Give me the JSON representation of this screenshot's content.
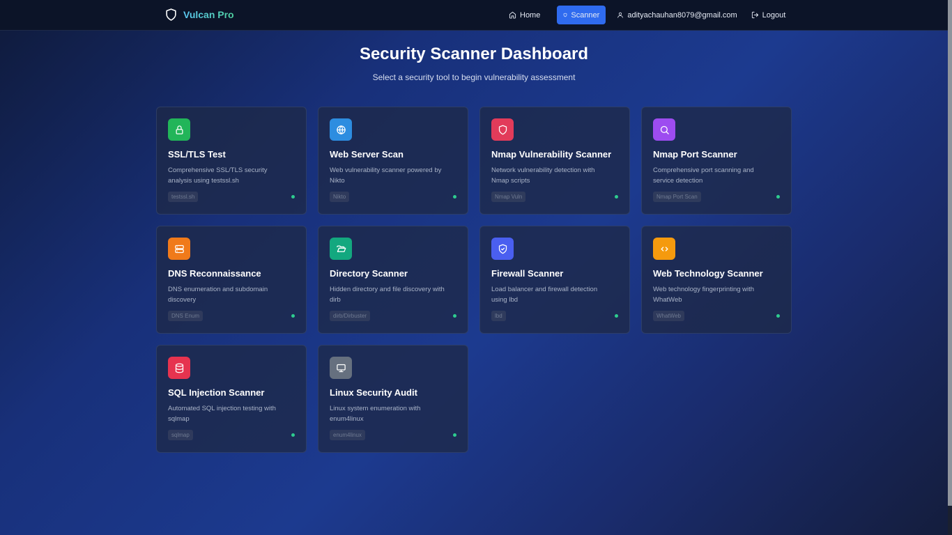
{
  "nav": {
    "brand": "Vulcan Pro",
    "home": "Home",
    "scanner": "Scanner",
    "user_email": "adityachauhan8079@gmail.com",
    "logout": "Logout"
  },
  "page": {
    "title": "Security Scanner Dashboard",
    "subtitle": "Select a security tool to begin vulnerability assessment"
  },
  "tools": [
    {
      "title": "SSL/TLS Test",
      "desc": "Comprehensive SSL/TLS security analysis using testssl.sh",
      "tag": "testssl.sh",
      "icon": "lock-icon",
      "color": "#22b559"
    },
    {
      "title": "Web Server Scan",
      "desc": "Web vulnerability scanner powered by Nikto",
      "tag": "Nikto",
      "icon": "globe-icon",
      "color": "#2d8de0"
    },
    {
      "title": "Nmap Vulnerability Scanner",
      "desc": "Network vulnerability detection with Nmap scripts",
      "tag": "Nmap Vuln",
      "icon": "shield-icon",
      "color": "#e23b5a"
    },
    {
      "title": "Nmap Port Scanner",
      "desc": "Comprehensive port scanning and service detection",
      "tag": "Nmap Port Scan",
      "icon": "search-icon",
      "color": "#9d4cf0"
    },
    {
      "title": "DNS Reconnaissance",
      "desc": "DNS enumeration and subdomain discovery",
      "tag": "DNS Enum",
      "icon": "server-icon",
      "color": "#f07a1a"
    },
    {
      "title": "Directory Scanner",
      "desc": "Hidden directory and file discovery with dirb",
      "tag": "dirb/Dirbuster",
      "icon": "folder-open-icon",
      "color": "#13a87f"
    },
    {
      "title": "Firewall Scanner",
      "desc": "Load balancer and firewall detection using lbd",
      "tag": "lbd",
      "icon": "shield-check-icon",
      "color": "#4a5ff0"
    },
    {
      "title": "Web Technology Scanner",
      "desc": "Web technology fingerprinting with WhatWeb",
      "tag": "WhatWeb",
      "icon": "code-icon",
      "color": "#f59a0e"
    },
    {
      "title": "SQL Injection Scanner",
      "desc": "Automated SQL injection testing with sqlmap",
      "tag": "sqlmap",
      "icon": "database-icon",
      "color": "#e6334f"
    },
    {
      "title": "Linux Security Audit",
      "desc": "Linux system enumeration with enum4linux",
      "tag": "enum4linux",
      "icon": "monitor-icon",
      "color": "#66707f"
    }
  ]
}
